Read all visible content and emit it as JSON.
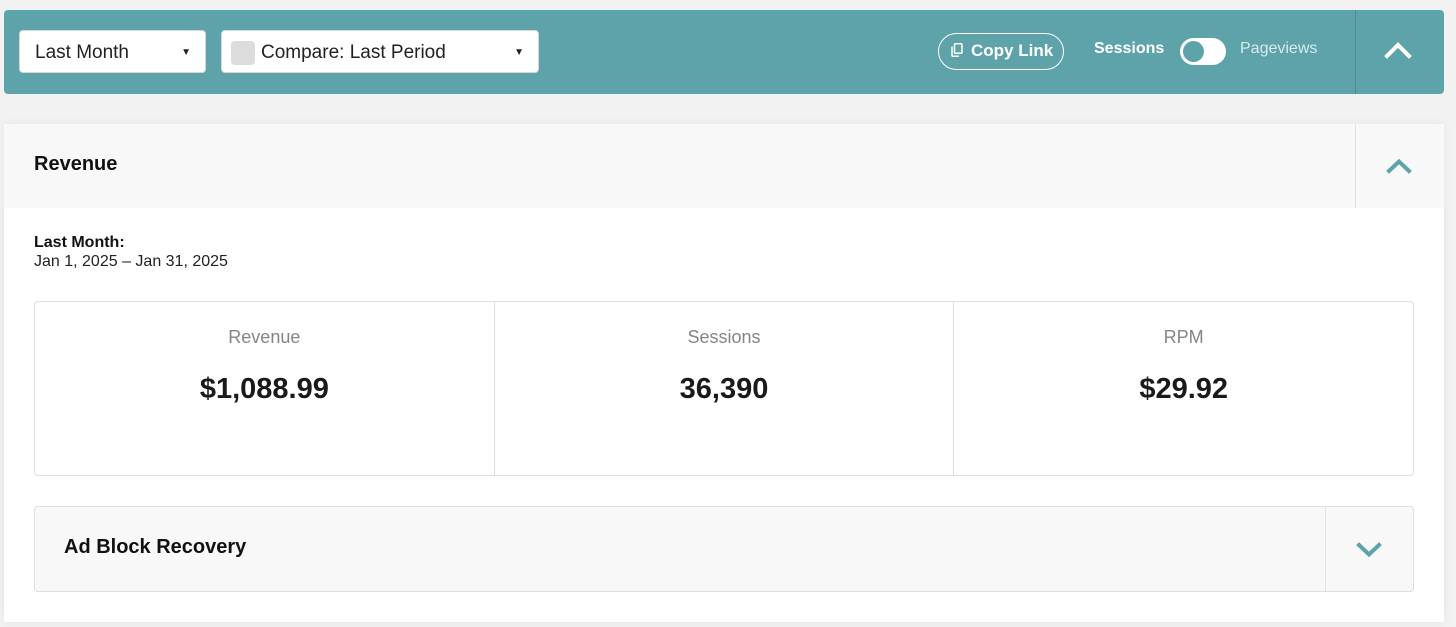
{
  "toolbar": {
    "period_select": "Last Month",
    "compare_select": "Compare: Last Period",
    "copy_link": "Copy Link",
    "toggle_left_label": "Sessions",
    "toggle_right_label": "Pageviews",
    "toggle_state": "Sessions",
    "collapse_icon": "chevron-up-icon"
  },
  "revenue_panel": {
    "title": "Revenue",
    "collapse_icon": "chevron-up-icon",
    "period_title": "Last Month:",
    "period_range": "Jan 1, 2025 – Jan 31, 2025",
    "metrics": [
      {
        "label": "Revenue",
        "value": "$1,088.99"
      },
      {
        "label": "Sessions",
        "value": "36,390"
      },
      {
        "label": "RPM",
        "value": "$29.92"
      }
    ]
  },
  "ad_block_panel": {
    "title": "Ad Block Recovery",
    "expand_icon": "chevron-down-icon"
  },
  "colors": {
    "accent": "#5fa3aa",
    "background": "#f2f2f2"
  }
}
